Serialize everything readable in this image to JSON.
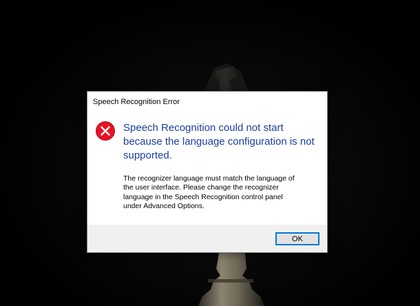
{
  "dialog": {
    "title": "Speech Recognition Error",
    "icon": "error-icon",
    "main_instruction": "Speech Recognition could not start because the language configuration is not supported.",
    "content": "The recognizer language must match the language of\nthe user interface.  Please change the recognizer\nlanguage in the Speech Recognition control panel\nunder Advanced Options.",
    "ok_label": "OK"
  },
  "colors": {
    "instruction_text": "#1a3ea0",
    "error_icon": "#e81123",
    "button_focus_border": "#0078d7",
    "button_bar": "#f0f0f0"
  },
  "wallpaper": {
    "subject": "chess-king-piece"
  }
}
